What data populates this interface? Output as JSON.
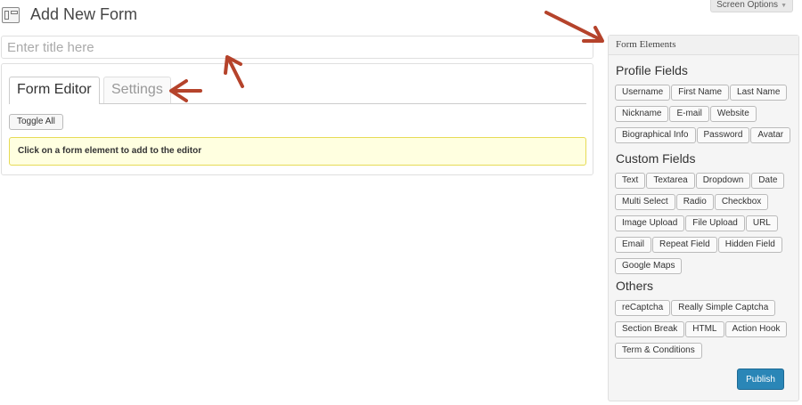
{
  "header": {
    "icon": "form-page-icon",
    "title": "Add New Form",
    "screen_options": "Screen Options"
  },
  "title_input": {
    "placeholder": "Enter title here",
    "value": ""
  },
  "editor": {
    "tabs": [
      {
        "label": "Form Editor",
        "active": true
      },
      {
        "label": "Settings",
        "active": false
      }
    ],
    "toggle_all": "Toggle All",
    "notice": "Click on a form element to add to the editor"
  },
  "form_elements": {
    "title": "Form Elements",
    "profile": {
      "heading": "Profile Fields",
      "items": [
        "Username",
        "First Name",
        "Last Name",
        "Nickname",
        "E-mail",
        "Website",
        "Biographical Info",
        "Password",
        "Avatar"
      ]
    },
    "custom": {
      "heading": "Custom Fields",
      "items": [
        "Text",
        "Textarea",
        "Dropdown",
        "Date",
        "Multi Select",
        "Radio",
        "Checkbox",
        "Image Upload",
        "File Upload",
        "URL",
        "Email",
        "Repeat Field",
        "Hidden Field",
        "Google Maps"
      ]
    },
    "others": {
      "heading": "Others",
      "items": [
        "reCaptcha",
        "Really Simple Captcha",
        "Section Break",
        "HTML",
        "Action Hook",
        "Term & Conditions"
      ]
    },
    "publish": "Publish"
  },
  "colors": {
    "arrow": "#b5432b",
    "publish": "#2a86b7",
    "notice_bg": "#ffffe0"
  }
}
